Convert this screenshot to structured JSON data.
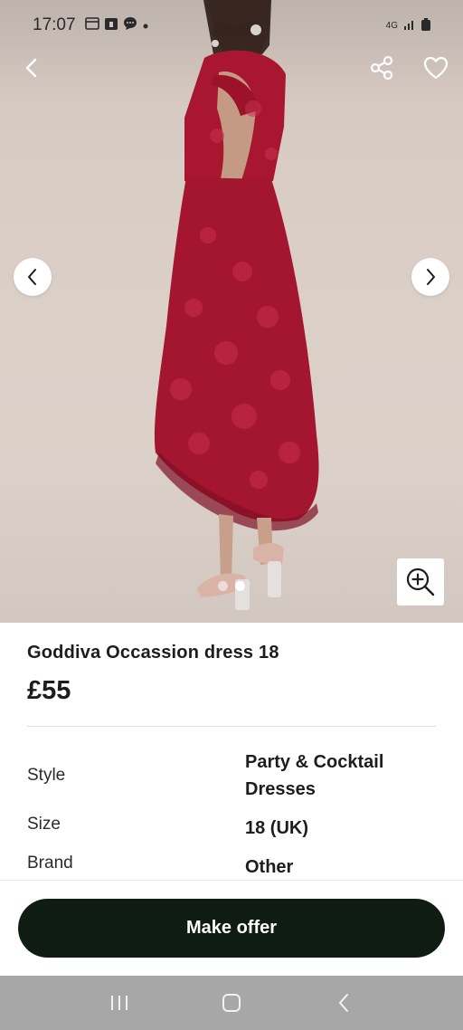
{
  "status_bar": {
    "time": "17:07",
    "notification_icons": [
      "calendar-icon",
      "date-badge-icon",
      "chat-bubble-icon",
      "more-dot-icon"
    ],
    "network_label": "4G",
    "indicators": [
      "signal-icon",
      "battery-icon"
    ]
  },
  "top_actions": {
    "back_icon": "chevron-left-icon",
    "share_icon": "share-icon",
    "favorite_icon": "heart-icon"
  },
  "gallery": {
    "image_subject": "red lace occasion dress",
    "total_images": 2,
    "active_index": 1,
    "prev_icon": "chevron-left-icon",
    "next_icon": "chevron-right-icon",
    "zoom_icon": "zoom-in-icon"
  },
  "product": {
    "title": "Goddiva Occassion dress 18",
    "price": "£55"
  },
  "attributes": [
    {
      "label": "Style",
      "value": "Party & Cocktail Dresses"
    },
    {
      "label": "Size",
      "value": "18 (UK)"
    },
    {
      "label": "Brand",
      "value": "Other"
    }
  ],
  "cta": {
    "make_offer_label": "Make offer"
  },
  "system_nav": {
    "items": [
      "recent-apps-icon",
      "home-icon",
      "back-icon"
    ]
  },
  "colors": {
    "accent_dark": "#0f1c14",
    "dress_red": "#b01c3c",
    "nav_bar": "#a7a7a7"
  }
}
